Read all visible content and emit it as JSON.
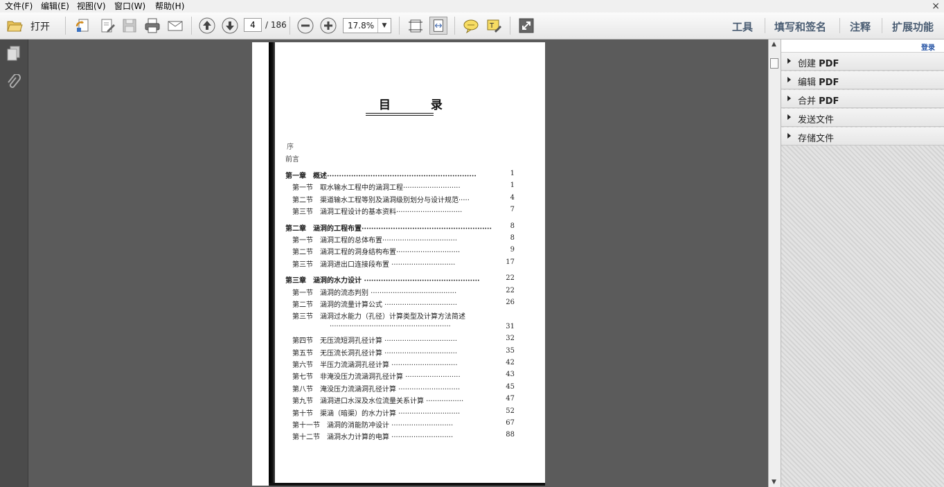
{
  "menu": [
    {
      "label": "文件(F)"
    },
    {
      "label": "编辑(E)"
    },
    {
      "label": "视图(V)"
    },
    {
      "label": "窗口(W)"
    },
    {
      "label": "帮助(H)"
    }
  ],
  "window": {
    "close_glyph": "×"
  },
  "toolbar": {
    "open_label": "打开",
    "page_current": "4",
    "page_total": "/ 186",
    "zoom": "17.8%",
    "right_links": [
      "工具",
      "填写和签名",
      "注释",
      "扩展功能"
    ]
  },
  "document": {
    "title": "目 录",
    "preface_lines": [
      "序",
      "前言"
    ],
    "entries": [
      {
        "kind": "chapter",
        "text": "第一章　概述······························································",
        "page": "1"
      },
      {
        "kind": "section",
        "text": "第一节　取水输水工程中的涵洞工程··························",
        "page": "1"
      },
      {
        "kind": "section",
        "text": "第二节　渠道输水工程等别及涵洞级别划分与设计规范·····",
        "page": "4"
      },
      {
        "kind": "section",
        "text": "第三节　涵洞工程设计的基本资料······························",
        "page": "7"
      },
      {
        "kind": "chapter",
        "text": "第二章　涵洞的工程布置······················································",
        "page": "8"
      },
      {
        "kind": "section",
        "text": "第一节　涵洞工程的总体布置··································",
        "page": "8"
      },
      {
        "kind": "section",
        "text": "第二节　涵洞工程的洞身结构布置·····························",
        "page": "9"
      },
      {
        "kind": "section",
        "text": "第三节　涵洞进出口连接段布置 ·····························",
        "page": "17"
      },
      {
        "kind": "chapter",
        "text": "第三章　涵洞的水力设计 ················································",
        "page": "22"
      },
      {
        "kind": "section",
        "text": "第一节　涵洞的流态判别 ·······································",
        "page": "22"
      },
      {
        "kind": "section",
        "text": "第二节　涵洞的流量计算公式 ·································",
        "page": "26"
      },
      {
        "kind": "section",
        "text": "第三节　涵洞过水能力（孔径）计算类型及计算方法简述",
        "page": ""
      },
      {
        "kind": "cont",
        "text": "·······················································",
        "page": "31"
      },
      {
        "kind": "section",
        "text": "第四节　无压流短洞孔径计算 ·································",
        "page": "32"
      },
      {
        "kind": "section",
        "text": "第五节　无压流长洞孔径计算 ·································",
        "page": "35"
      },
      {
        "kind": "section",
        "text": "第六节　半压力流涵洞孔径计算 ······························",
        "page": "42"
      },
      {
        "kind": "section",
        "text": "第七节　非淹没压力流涵洞孔径计算 ·························",
        "page": "43"
      },
      {
        "kind": "section",
        "text": "第八节　淹没压力流涵洞孔径计算 ····························",
        "page": "45"
      },
      {
        "kind": "section",
        "text": "第九节　涵洞进口水深及水位流量关系计算 ·················",
        "page": "47"
      },
      {
        "kind": "section",
        "text": "第十节　渠涵（暗渠）的水力计算 ····························",
        "page": "52"
      },
      {
        "kind": "section",
        "text": "第十一节　涵洞的消能防冲设计 ····························",
        "page": "67"
      },
      {
        "kind": "section",
        "text": "第十二节　涵洞水力计算的电算 ····························",
        "page": "88"
      }
    ]
  },
  "right_panel": {
    "login": "登录",
    "items": [
      {
        "prefix": "创建 ",
        "bold": "PDF"
      },
      {
        "prefix": "编辑 ",
        "bold": "PDF"
      },
      {
        "prefix": "合并 ",
        "bold": "PDF"
      },
      {
        "prefix": "发送文件",
        "bold": ""
      },
      {
        "prefix": "存储文件",
        "bold": ""
      }
    ]
  }
}
